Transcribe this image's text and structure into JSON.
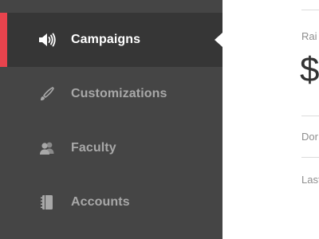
{
  "sidebar": {
    "items": [
      {
        "label": "Campaigns",
        "icon": "megaphone-icon",
        "active": true
      },
      {
        "label": "Customizations",
        "icon": "brush-icon",
        "active": false
      },
      {
        "label": "Faculty",
        "icon": "users-icon",
        "active": false
      },
      {
        "label": "Accounts",
        "icon": "address-book-icon",
        "active": false
      }
    ]
  },
  "content": {
    "raised_label": "Rai",
    "amount": "$",
    "donations_label": "Dor",
    "last_label": "Last"
  },
  "colors": {
    "sidebar_bg": "#454545",
    "active_bg": "#363636",
    "accent": "#e8434d",
    "inactive_text": "#a8a8a8",
    "active_text": "#ffffff"
  }
}
